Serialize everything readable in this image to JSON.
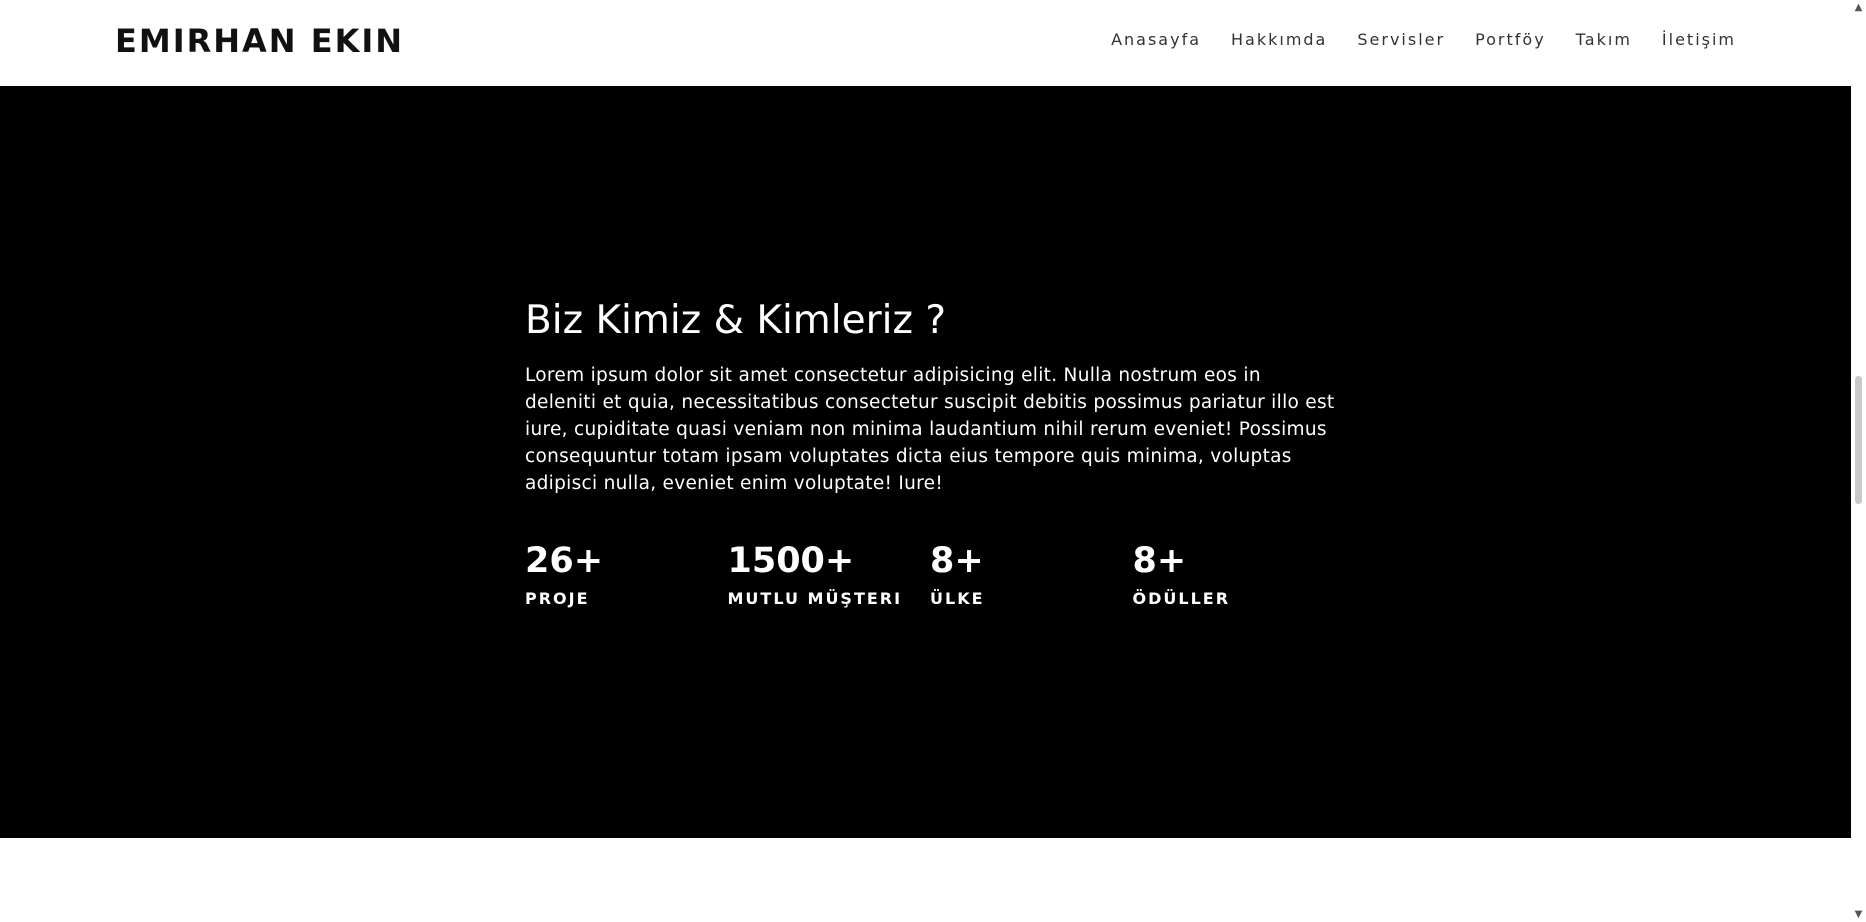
{
  "header": {
    "brand": "EMIRHAN EKIN",
    "nav": [
      {
        "label": "Anasayfa"
      },
      {
        "label": "Hakkımda"
      },
      {
        "label": "Servisler"
      },
      {
        "label": "Portföy"
      },
      {
        "label": "Takım"
      },
      {
        "label": "İletişim"
      }
    ]
  },
  "about": {
    "title": "Biz Kimiz & Kimleriz ?",
    "text": "Lorem ipsum dolor sit amet consectetur adipisicing elit. Nulla nostrum eos in deleniti et quia, necessitatibus consectetur suscipit debitis possimus pariatur illo est iure, cupiditate quasi veniam non minima laudantium nihil rerum eveniet! Possimus consequuntur totam ipsam voluptates dicta eius tempore quis minima, voluptas adipisci nulla, eveniet enim voluptate! Iure!",
    "stats": [
      {
        "value": "26+",
        "label": "PROJE"
      },
      {
        "value": "1500+",
        "label": "MUTLU MÜŞTERI"
      },
      {
        "value": "8+",
        "label": "ÜLKE"
      },
      {
        "value": "8+",
        "label": "ÖDÜLLER"
      }
    ]
  },
  "scrollbar": {
    "up_icon": "▲",
    "down_icon": "▼"
  },
  "colors": {
    "hero_background": "#000000",
    "page_background": "#ffffff",
    "brand_text": "#111111",
    "nav_text": "#333333"
  }
}
